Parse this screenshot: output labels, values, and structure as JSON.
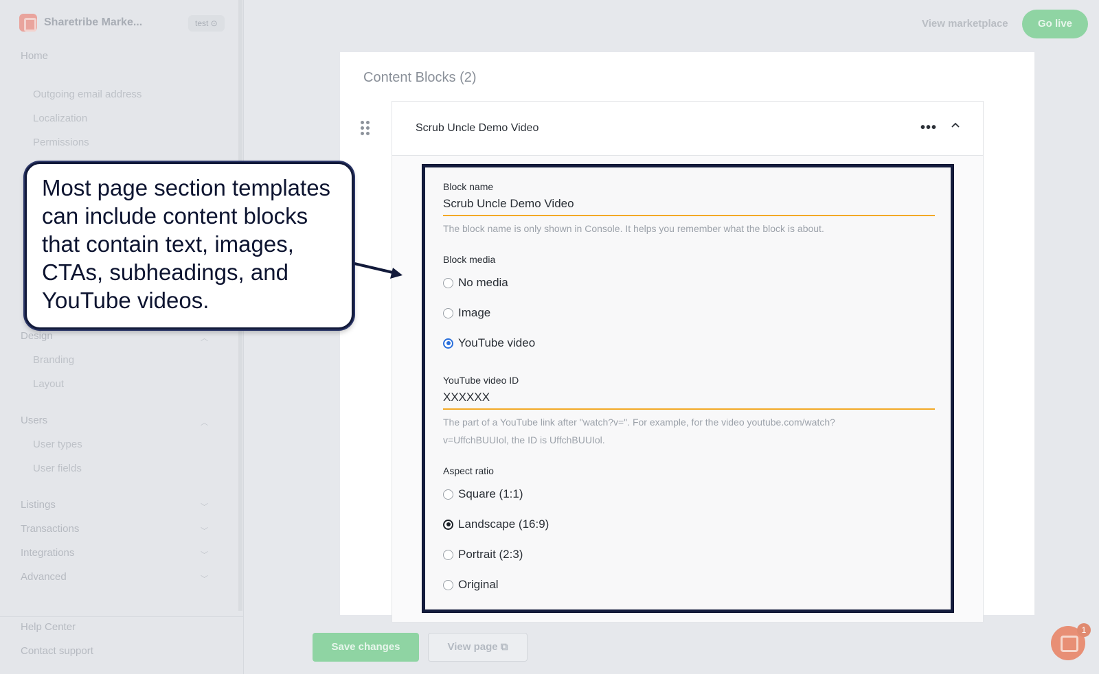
{
  "app": {
    "brand_name": "Sharetribe Marke...",
    "env_badge": "test",
    "view_marketplace": "View marketplace",
    "go_live": "Go live"
  },
  "sidebar": {
    "home": "Home",
    "sub_items_top": [
      "Outgoing email address",
      "Localization",
      "Permissions"
    ],
    "design": {
      "label": "Design",
      "items": [
        "Branding",
        "Layout"
      ]
    },
    "users": {
      "label": "Users",
      "items": [
        "User types",
        "User fields"
      ]
    },
    "collapsed_sections": [
      "Listings",
      "Transactions",
      "Integrations",
      "Advanced"
    ],
    "bottom_links": [
      "Help Center",
      "Contact support"
    ]
  },
  "footer": {
    "save_changes": "Save changes",
    "view_page": "View page",
    "chat_badge_count": "1"
  },
  "main": {
    "section_title": "Content Blocks (2)",
    "block": {
      "header_title": "Scrub Uncle Demo Video",
      "block_name": {
        "label": "Block name",
        "value": "Scrub Uncle Demo Video",
        "help": "The block name is only shown in Console. It helps you remember what the block is about."
      },
      "block_media": {
        "label": "Block media",
        "options": [
          "No media",
          "Image",
          "YouTube video"
        ],
        "selected": "YouTube video"
      },
      "youtube_id": {
        "label": "YouTube video ID",
        "value": "XXXXXX",
        "help_line1": "The part of a YouTube link after \"watch?v=\". For example, for the video youtube.com/watch?",
        "help_line2": "v=UffchBUUIol, the ID is UffchBUUIol."
      },
      "aspect_ratio": {
        "label": "Aspect ratio",
        "options": [
          "Square (1:1)",
          "Landscape (16:9)",
          "Portrait (2:3)",
          "Original"
        ],
        "selected": "Landscape (16:9)"
      }
    }
  },
  "callout": {
    "text": "Most page section templates can include content blocks that contain text, images, CTAs, subheadings, and YouTube videos."
  },
  "colors": {
    "focus_underline": "#f3a926",
    "highlight_border": "#141c3d",
    "radio_blue": "#2a6fdb",
    "go_live_green": "#8fd4a3"
  }
}
